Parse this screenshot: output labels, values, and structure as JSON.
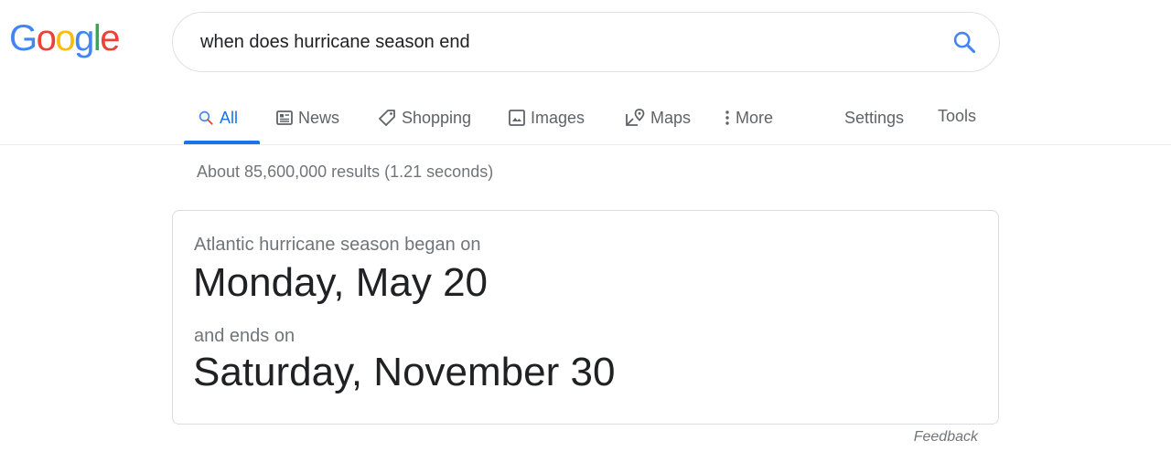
{
  "logo": {
    "letters": [
      "G",
      "o",
      "o",
      "g",
      "l",
      "e"
    ],
    "colors": [
      "#4285F4",
      "#EA4335",
      "#FBBC05",
      "#4285F4",
      "#34A853",
      "#EA4335"
    ]
  },
  "search": {
    "query": "when does hurricane season end",
    "button_icon": "search-icon",
    "accent_color": "#4285F4"
  },
  "tabs": [
    {
      "label": "All",
      "icon": "search-icon",
      "active": true
    },
    {
      "label": "News",
      "icon": "newspaper-icon",
      "active": false
    },
    {
      "label": "Shopping",
      "icon": "tag-icon",
      "active": false
    },
    {
      "label": "Images",
      "icon": "image-icon",
      "active": false
    },
    {
      "label": "Maps",
      "icon": "map-pin-icon",
      "active": false
    },
    {
      "label": "More",
      "icon": "more-vertical-icon",
      "active": false
    },
    {
      "label": "Settings",
      "icon": null,
      "active": false
    },
    {
      "label": "Tools",
      "icon": null,
      "active": false
    }
  ],
  "result_stats": "About 85,600,000 results (1.21 seconds)",
  "answer_card": {
    "start_label": "Atlantic hurricane season began on",
    "start_date": "Monday, May 20",
    "end_label": "and ends on",
    "end_date": "Saturday, November 30"
  },
  "feedback_label": "Feedback"
}
